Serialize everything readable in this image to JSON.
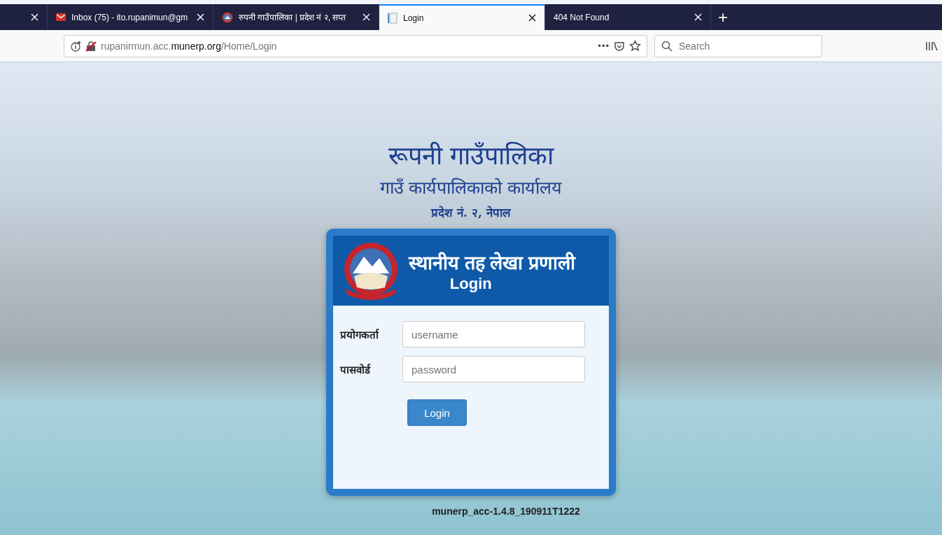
{
  "tabs": [
    {
      "kind": "blank",
      "selected": false
    },
    {
      "kind": "mail",
      "title": "Inbox (75) - ito.rupanimun@gm",
      "selected": false
    },
    {
      "kind": "emblem",
      "title": "रुपनी गाउँपालिका | प्रदेश नं २, सप्त",
      "selected": false
    },
    {
      "kind": "page",
      "title": "Login",
      "selected": true
    },
    {
      "kind": "none",
      "title": "404 Not Found",
      "selected": false
    }
  ],
  "new_tab": "+",
  "address_bar": {
    "url": "rupanirmun.acc.**munerp.org**/Home/Login",
    "page_actions": "•••"
  },
  "search": {
    "placeholder": "Search"
  },
  "page": {
    "heading": "रूपनी गाउँपालिका",
    "subheading": "गाउँ कार्यपालिकाको कार्यालय",
    "address": "प्रदेश नं. २, नेपाल",
    "card": {
      "title": "स्थानीय तह लेखा प्रणाली",
      "subtitle": "Login",
      "fields": [
        {
          "label": "प्रयोगकर्ता",
          "placeholder": "username"
        },
        {
          "label": "पासवोर्ड",
          "placeholder": "password"
        }
      ],
      "button": "Login"
    },
    "version": "munerp_acc-1.4.8_190911T1222"
  }
}
